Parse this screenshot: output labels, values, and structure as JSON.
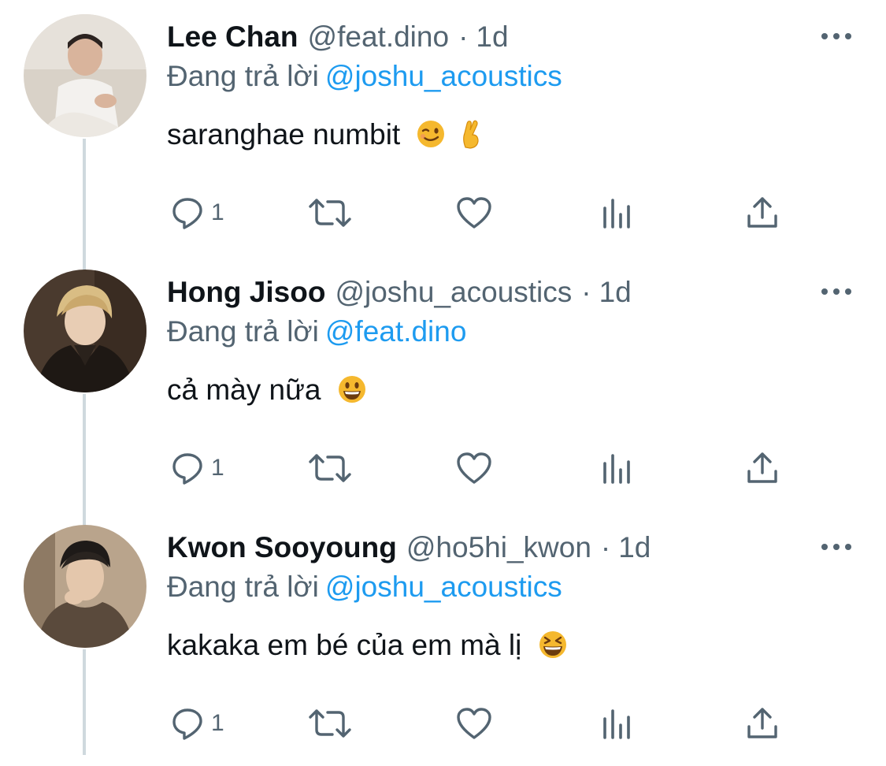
{
  "reply_prefix": "Đang trả lời",
  "tweets": [
    {
      "display_name": "Lee Chan",
      "handle": "@feat.dino",
      "separator": "·",
      "time": "1d",
      "reply_to": "@joshu_acoustics",
      "text": "saranghae numbit",
      "emojis": [
        "winking-face-emoji",
        "crossed-fingers-emoji"
      ],
      "reply_count": "1",
      "avatar": "avatar-lee-chan"
    },
    {
      "display_name": "Hong Jisoo",
      "handle": "@joshu_acoustics",
      "separator": "·",
      "time": "1d",
      "reply_to": "@feat.dino",
      "text": "cả mày nữa",
      "emojis": [
        "grinning-face-emoji"
      ],
      "reply_count": "1",
      "avatar": "avatar-hong-jisoo"
    },
    {
      "display_name": "Kwon Sooyoung",
      "handle": "@ho5hi_kwon",
      "separator": "·",
      "time": "1d",
      "reply_to": "@joshu_acoustics",
      "text": "kakaka em bé của em mà lị",
      "emojis": [
        "grinning-squinting-face-emoji"
      ],
      "reply_count": "1",
      "avatar": "avatar-kwon-sooyoung"
    }
  ],
  "icons": {
    "more": "more-horizontal-icon",
    "reply": "reply-icon",
    "retweet": "retweet-icon",
    "like": "heart-icon",
    "views": "analytics-icon",
    "share": "share-icon"
  },
  "colors": {
    "text_primary": "#0f1419",
    "text_secondary": "#536471",
    "mention": "#1d9bf0",
    "thread_line": "#cfd9de",
    "background": "#ffffff"
  }
}
